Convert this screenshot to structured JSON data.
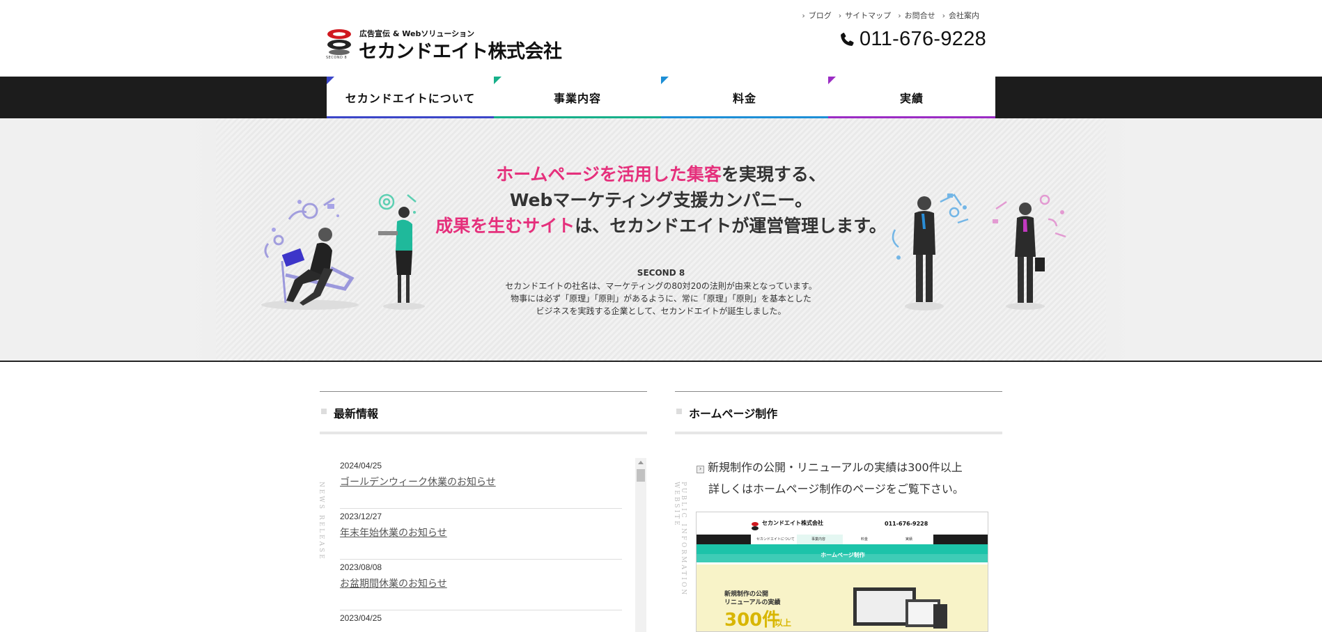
{
  "header": {
    "logo_sub": "広告宣伝 & Webソリューション",
    "logo_name": "セカンドエイト株式会社",
    "logo_small": "SECOND 8",
    "util_nav": [
      "ブログ",
      "サイトマップ",
      "お問合せ",
      "会社案内"
    ],
    "phone": "011-676-9228"
  },
  "gnav": {
    "items": [
      {
        "label": "セカンドエイトについて",
        "color": "#3b46c8"
      },
      {
        "label": "事業内容",
        "color": "#17b08a"
      },
      {
        "label": "料金",
        "color": "#1d8fd6"
      },
      {
        "label": "実績",
        "color": "#9b2cc4"
      }
    ]
  },
  "hero": {
    "line1_pink": "ホームページを活用した集客",
    "line1_rest": "を実現する、",
    "line2": "Webマーケティング支援カンパニー。",
    "line3_pink": "成果を生むサイト",
    "line3_rest": "は、セカンドエイトが運営管理します。",
    "sub_title": "SECOND 8",
    "sub_lines": [
      "セカンドエイトの社名は、マーケティングの80対20の法則が由来となっています。",
      "物事には必ず「原理」「原則」があるように、常に「原理」「原則」を基本とした",
      "ビジネスを実践する企業として、セカンドエイトが誕生しました。"
    ]
  },
  "news": {
    "title": "最新情報",
    "vertical_label": "NEWS RELEASE",
    "items": [
      {
        "date": "2024/04/25",
        "title": "ゴールデンウィーク休業のお知らせ"
      },
      {
        "date": "2023/12/27",
        "title": "年末年始休業のお知らせ"
      },
      {
        "date": "2023/08/08",
        "title": "お盆期間休業のお知らせ"
      },
      {
        "date": "2023/04/25",
        "title": ""
      }
    ]
  },
  "homepage": {
    "title": "ホームページ制作",
    "vertical_label": "PUBLIC INFORMATION WEBSITE",
    "line1": "新規制作の公開・リニューアルの実績は300件以上",
    "line2": "詳しくはホームページ制作のページをご覧下さい。",
    "thumb": {
      "logo": "セカンドエイト株式会社",
      "phone": "011-676-9228",
      "nav": [
        "セカンドエイトについて",
        "事業内容",
        "料金",
        "実績"
      ],
      "banner": "ホームページ制作",
      "copy1": "新規制作の公開",
      "copy2": "リニューアルの実績",
      "count": "300件",
      "count_suffix": "以上"
    }
  },
  "colors": {
    "accent_pink": "#e5307c",
    "nav_bar": "#1c1c1c",
    "thumb_teal": "#1cc3a9"
  }
}
